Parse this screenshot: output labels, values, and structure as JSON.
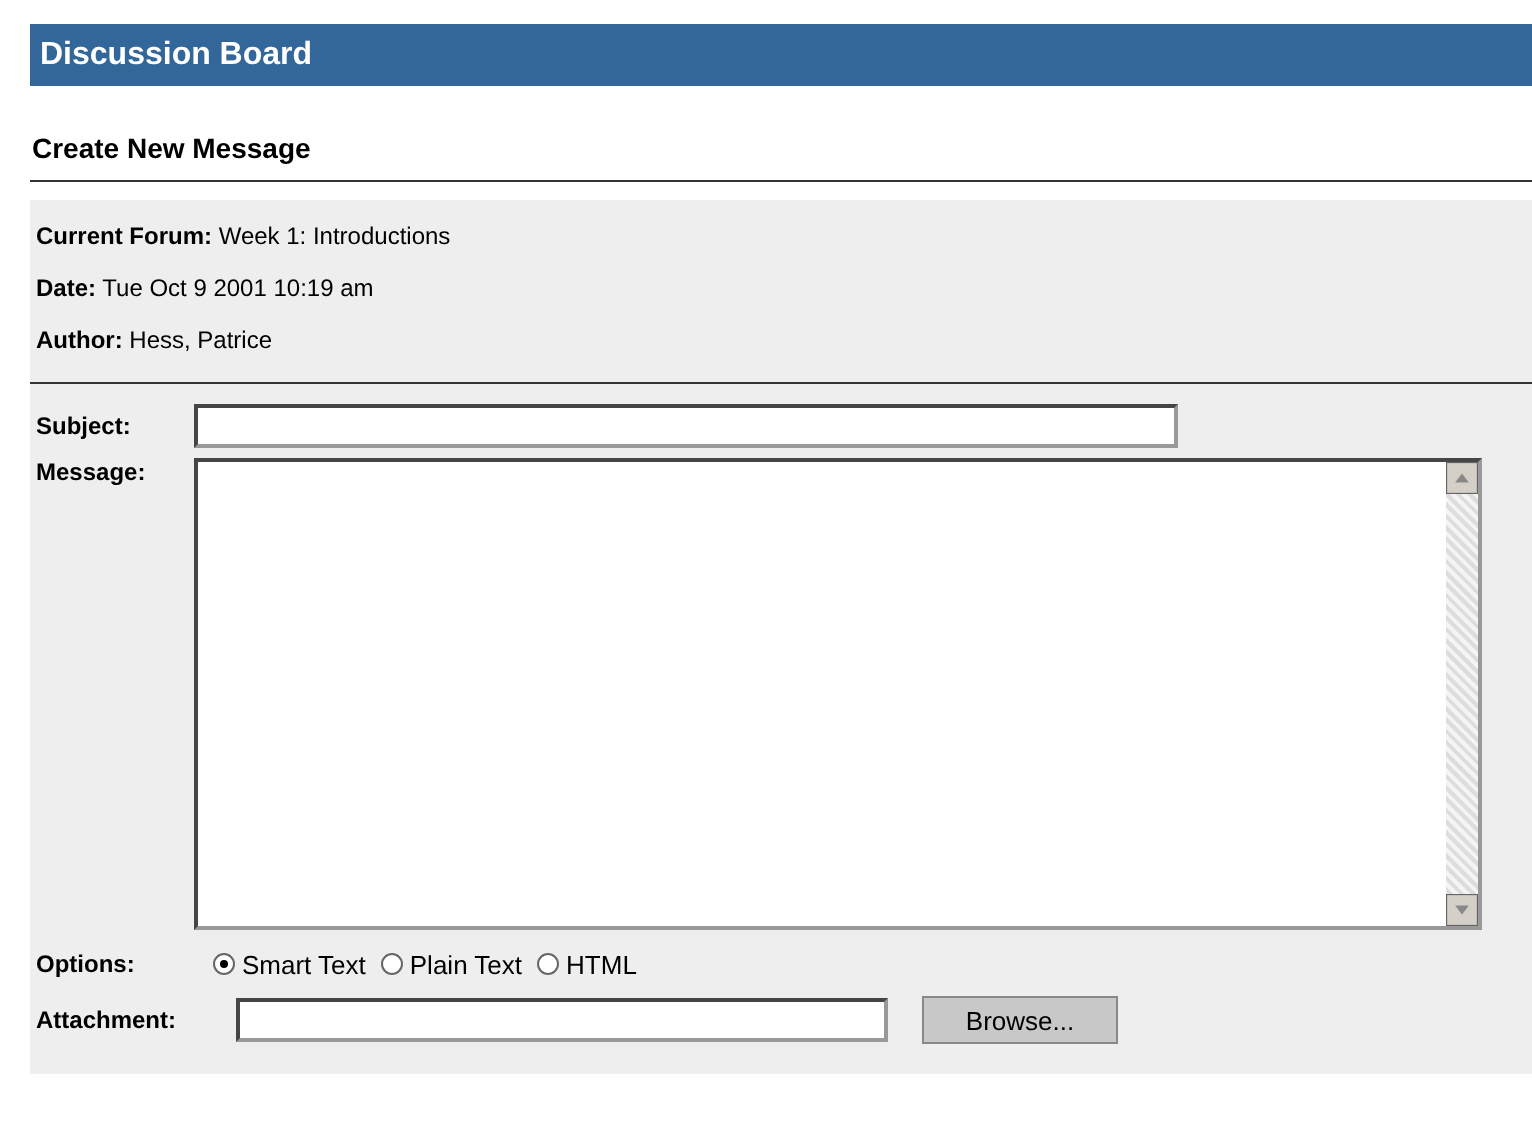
{
  "header": {
    "title": "Discussion Board"
  },
  "page_title": "Create New Message",
  "info": [
    {
      "label": "Current Forum:",
      "value": "Week 1: Introductions"
    },
    {
      "label": "Date:",
      "value": "Tue Oct 9 2001 10:19 am"
    },
    {
      "label": "Author:",
      "value": "Hess, Patrice"
    }
  ],
  "subject": {
    "label": "Subject:"
  },
  "message": {
    "label": "Message:"
  },
  "options": {
    "label": "Options:",
    "choices": [
      {
        "label": "Smart Text",
        "selected": true
      },
      {
        "label": "Plain Text",
        "selected": false
      },
      {
        "label": "HTML",
        "selected": false
      }
    ]
  },
  "attachment": {
    "label": "Attachment:",
    "button": "Browse..."
  }
}
